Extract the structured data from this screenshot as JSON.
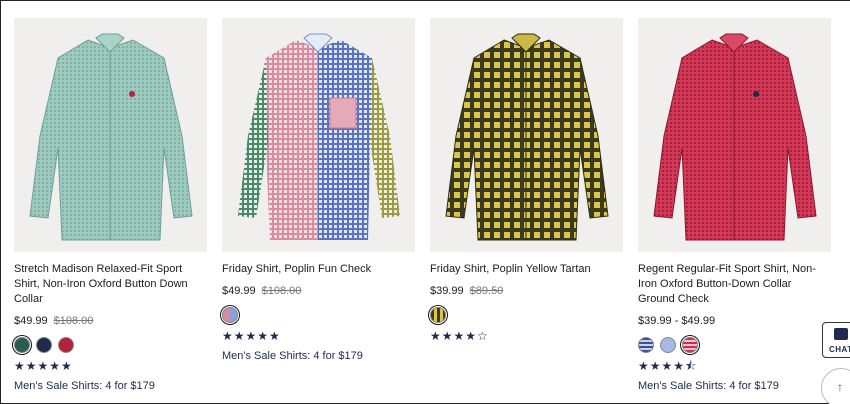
{
  "products": [
    {
      "title": "Stretch Madison Relaxed-Fit Sport Shirt, Non-Iron Oxford Button Down Collar",
      "price_now": "$49.99",
      "price_was": "$108.00",
      "stars": "★★★★★",
      "rating": 5,
      "promo": "Men's Sale Shirts: 4 for $179",
      "shirt_color": "#8fc1b5",
      "swatches": [
        "#2a5c52",
        "#1f2a4d",
        "#b3223a"
      ]
    },
    {
      "title": "Friday Shirt, Poplin Fun Check",
      "price_now": "$49.99",
      "price_was": "$108.00",
      "stars": "★★★★★",
      "rating": 5,
      "promo": "Men's Sale Shirts: 4 for $179",
      "shirt_color": "#c9d3ea",
      "swatches": [
        "#d9a3b0"
      ]
    },
    {
      "title": "Friday Shirt, Poplin Yellow Tartan",
      "price_now": "$39.99",
      "price_was": "$89.50",
      "stars": "★★★★☆",
      "rating": 4,
      "promo": "",
      "shirt_color": "#b59a2a",
      "swatches": [
        "#7b6a24"
      ]
    },
    {
      "title": "Regent Regular-Fit Sport Shirt, Non-Iron Oxford Button-Down Collar Ground Check",
      "price_now": "$39.99 - $49.99",
      "price_was": "",
      "stars": "★★★★⯪",
      "rating": 4.5,
      "promo": "Men's Sale Shirts: 4 for $179",
      "shirt_color": "#c9304e",
      "swatches": [
        "#3a4f9a",
        "#a8b8e6",
        "#c9304e"
      ]
    }
  ],
  "chat": {
    "label": "CHAT"
  },
  "scroll_top": {
    "glyph": "↑"
  }
}
